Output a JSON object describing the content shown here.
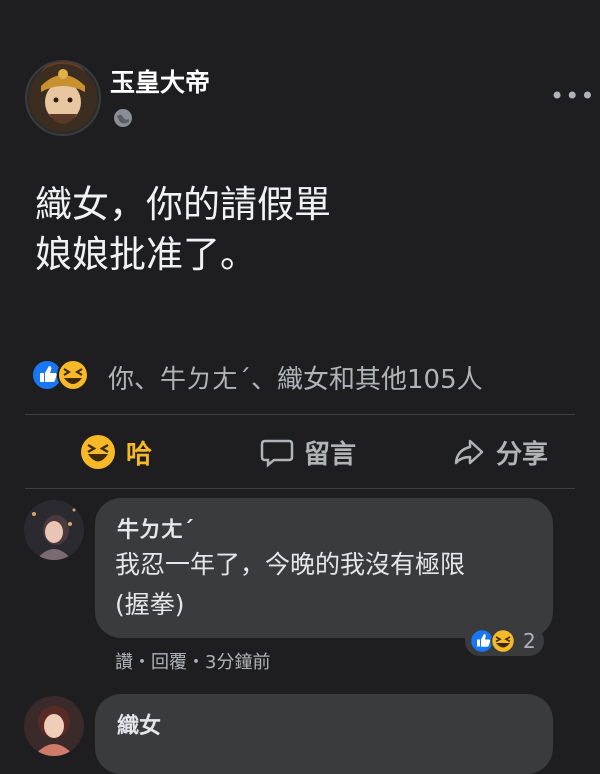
{
  "post": {
    "author": "玉皇大帝",
    "text_lines": [
      "織女，你的請假單",
      "娘娘批准了。"
    ],
    "reactions_text": "你、牛ㄉㄤˊ、織女和其他105人"
  },
  "actions": {
    "haha_label": "哈",
    "comment_label": "留言",
    "share_label": "分享"
  },
  "comments": [
    {
      "name": "牛ㄉㄤˊ",
      "text_lines": [
        "我忍一年了，今晚的我沒有極限",
        "(握拳)"
      ],
      "meta": "讚・回覆・3分鐘前",
      "reaction_count": "2"
    },
    {
      "name": "織女"
    }
  ],
  "colors": {
    "background": "#1e1e21",
    "bubble": "#3a3b3c",
    "like_blue": "#1877f2",
    "haha_yellow": "#f7b928"
  }
}
